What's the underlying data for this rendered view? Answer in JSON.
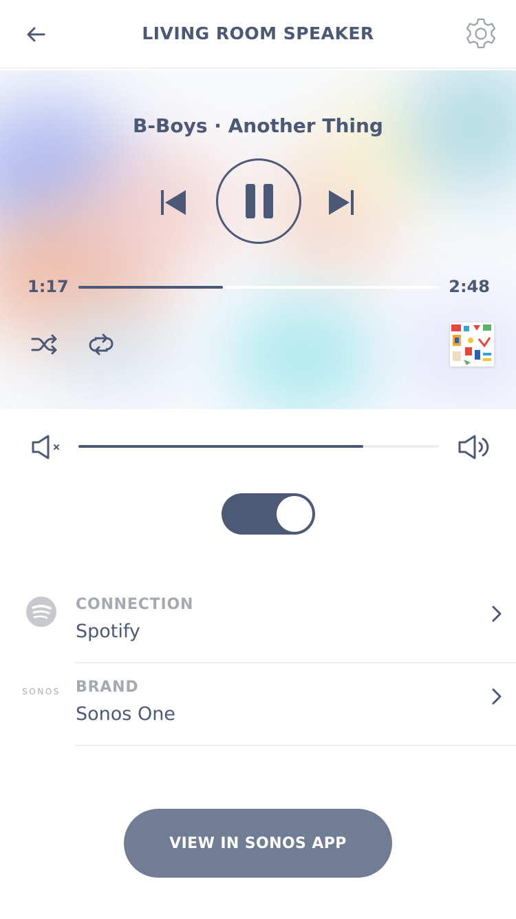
{
  "header": {
    "title": "LIVING ROOM SPEAKER",
    "back_icon": "arrow-left-icon",
    "settings_icon": "gear-icon"
  },
  "player": {
    "track": "B-Boys · Another Thing",
    "elapsed": "1:17",
    "total": "2:48",
    "progress_fraction": 0.4,
    "is_playing": true,
    "controls": [
      "previous-track-icon",
      "pause-icon",
      "next-track-icon",
      "shuffle-icon",
      "repeat-icon"
    ]
  },
  "volume": {
    "level_fraction": 0.79,
    "min_icon": "speaker-mute-icon",
    "max_icon": "speaker-loud-icon"
  },
  "toggle": {
    "on": true
  },
  "info": [
    {
      "label": "CONNECTION",
      "value": "Spotify",
      "icon": "spotify-icon"
    },
    {
      "label": "BRAND",
      "value": "Sonos One",
      "icon": "sonos-logo"
    }
  ],
  "logos": {
    "sonos": "SONOS"
  },
  "cta": {
    "label": "VIEW IN SONOS APP"
  },
  "colors": {
    "primary": "#4b5876",
    "muted_label": "#a5a9b2",
    "cta_bg": "#717d94"
  }
}
